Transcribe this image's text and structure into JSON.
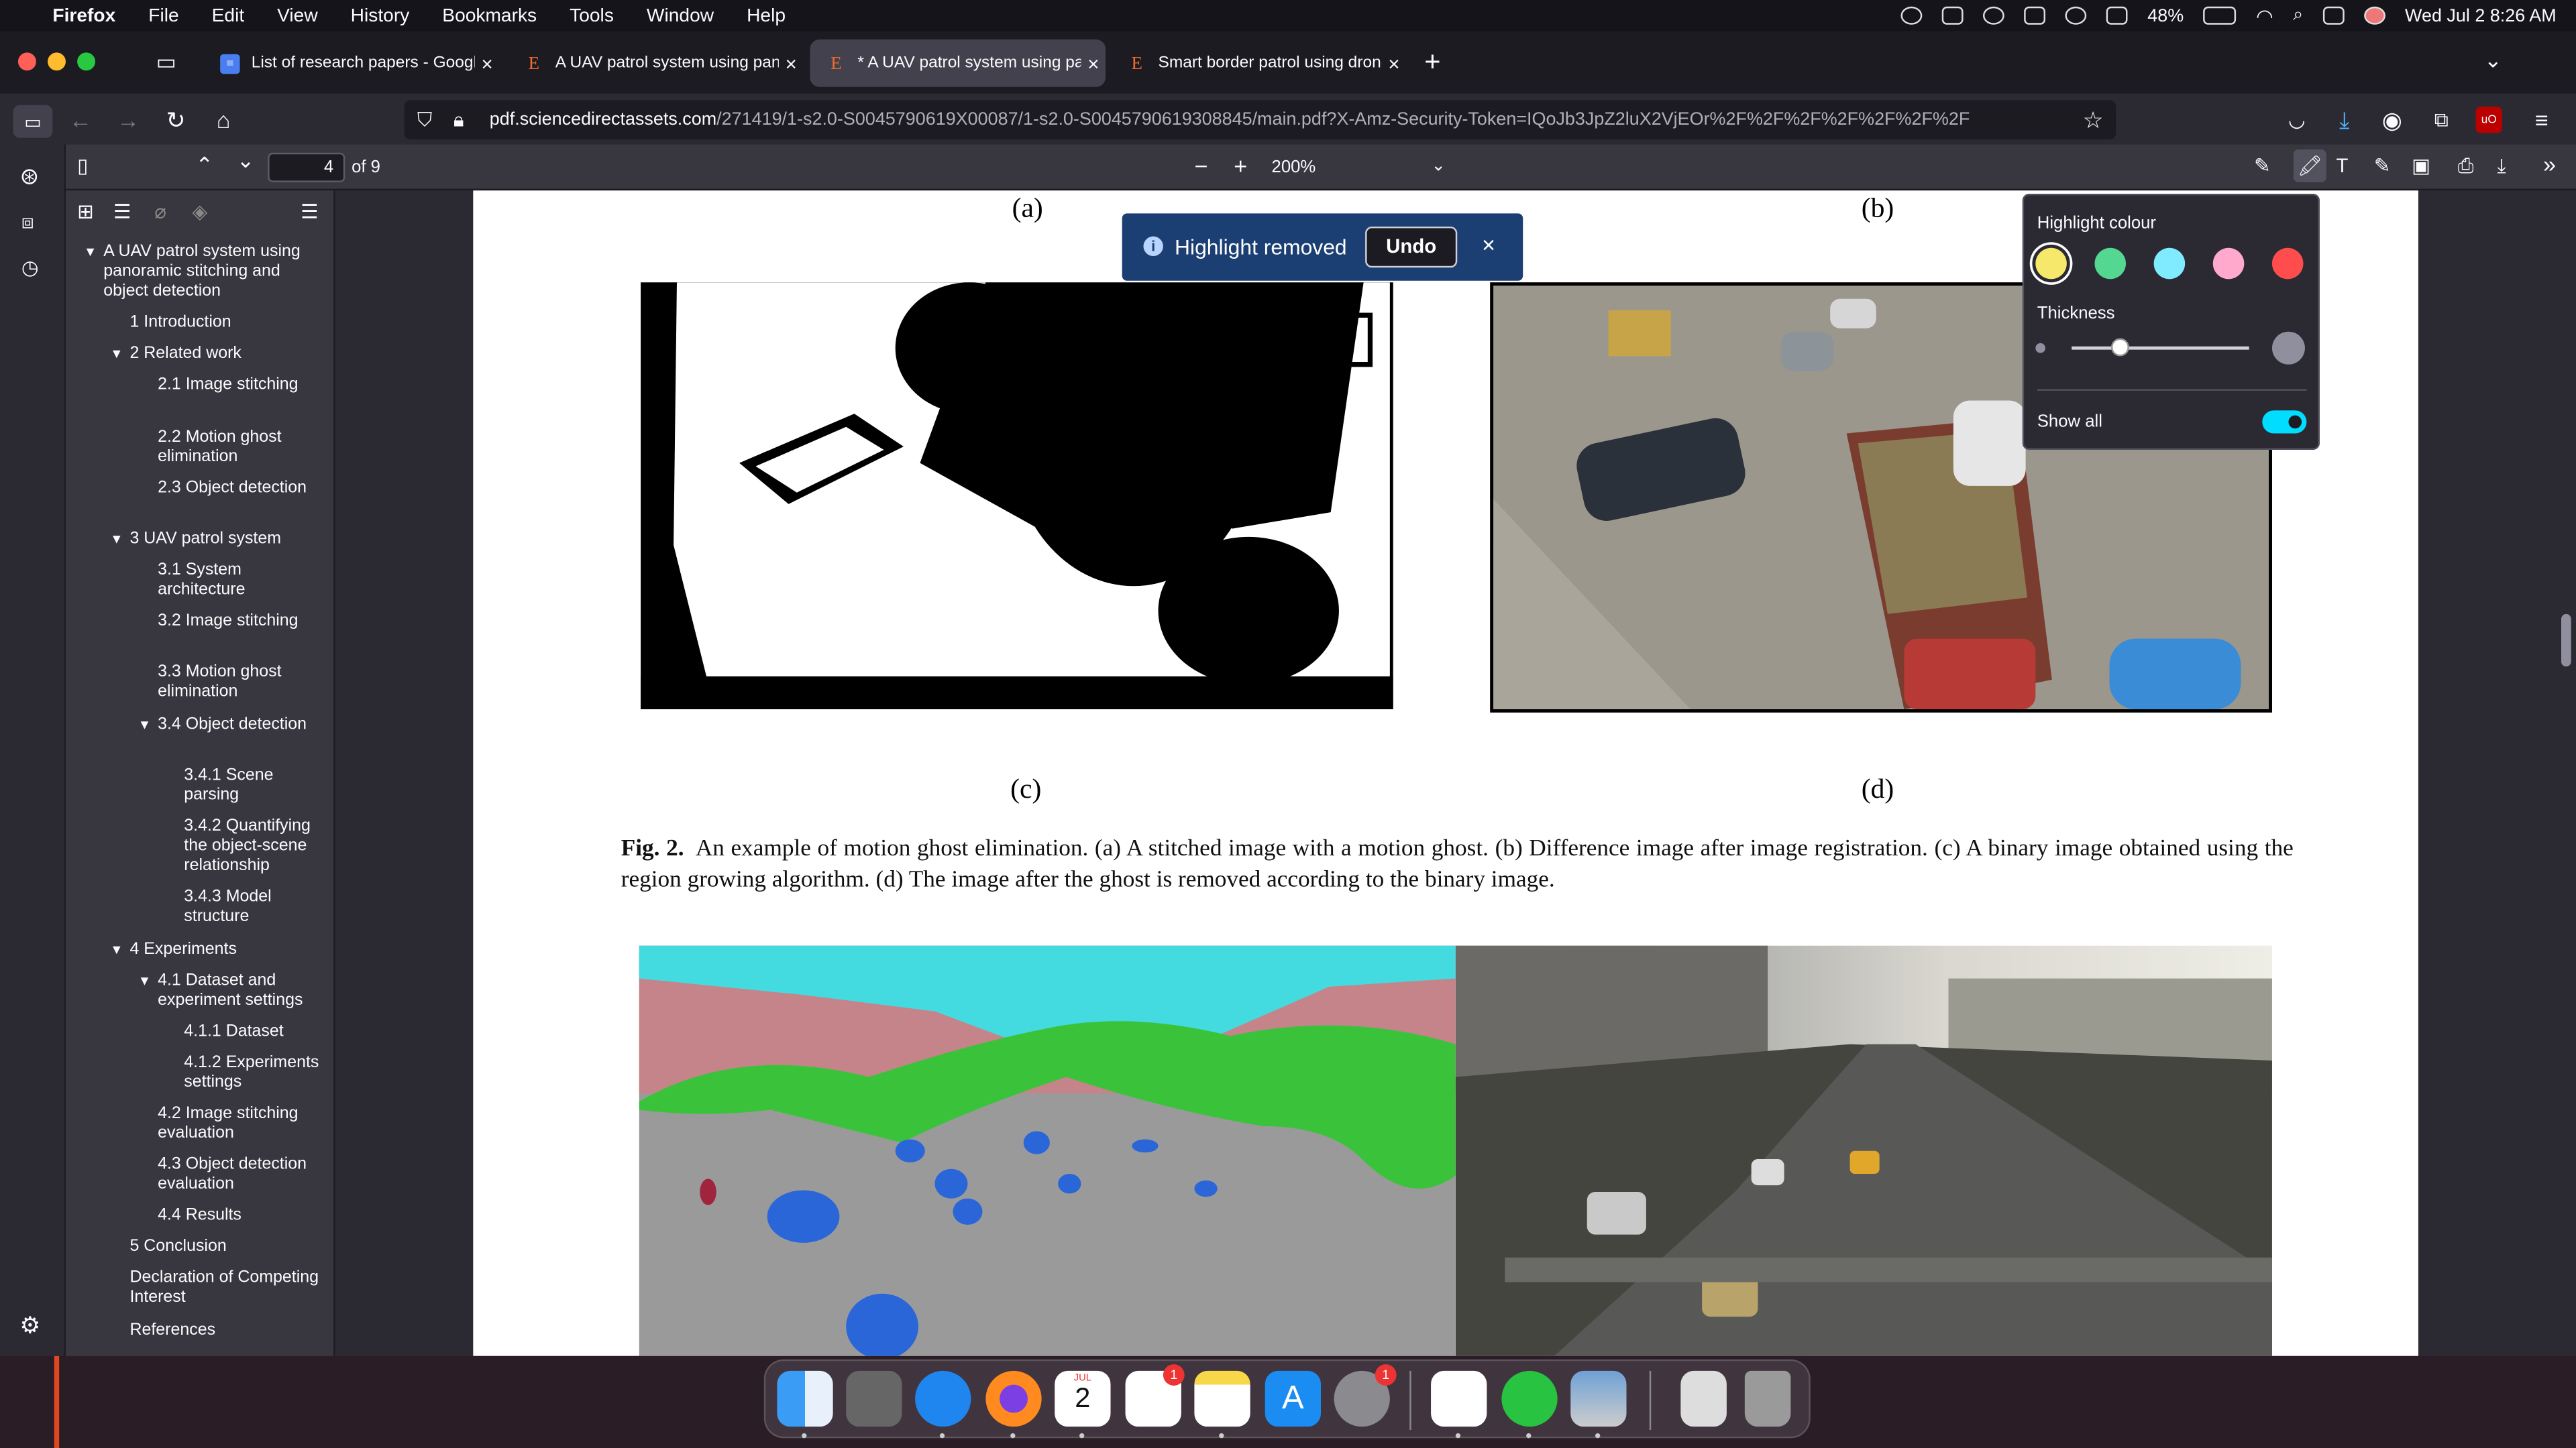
{
  "menubar": {
    "app": "Firefox",
    "items": [
      "File",
      "Edit",
      "View",
      "History",
      "Bookmarks",
      "Tools",
      "Window",
      "Help"
    ],
    "battery": "48%",
    "datetime": "Wed Jul 2  8:26 AM"
  },
  "tabs": [
    {
      "title": "List of research papers - Googl"
    },
    {
      "title": "A UAV patrol system using pano"
    },
    {
      "title": "* A UAV patrol system using par"
    },
    {
      "title": "Smart border patrol using drone"
    }
  ],
  "url": {
    "domain": "pdf.sciencedirectassets.com",
    "path": "/271419/1-s2.0-S0045790619X00087/1-s2.0-S0045790619308845/main.pdf?X-Amz-Security-Token=IQoJb3JpZ2luX2VjEOr%2F%2F%2F%2F%2F%2F%2F"
  },
  "pdf_toolbar": {
    "page": "4",
    "of_pages": "of 9",
    "zoom": "200%"
  },
  "outline": [
    {
      "label": "A UAV patrol system using panoramic stitching and object detection",
      "level": 0,
      "open": true
    },
    {
      "label": "1 Introduction",
      "level": 1
    },
    {
      "label": "2 Related work",
      "level": 1,
      "open": true
    },
    {
      "label": "2.1 Image stitching",
      "level": 2
    },
    {
      "label": "2.2 Motion ghost elimination",
      "level": 2
    },
    {
      "label": "2.3 Object detection",
      "level": 2
    },
    {
      "label": "3 UAV patrol system",
      "level": 1,
      "open": true
    },
    {
      "label": "3.1 System architecture",
      "level": 2
    },
    {
      "label": "3.2 Image stitching",
      "level": 2
    },
    {
      "label": "3.3 Motion ghost elimination",
      "level": 2
    },
    {
      "label": "3.4 Object detection",
      "level": 2,
      "open": true
    },
    {
      "label": "3.4.1 Scene parsing",
      "level": 3
    },
    {
      "label": "3.4.2 Quantifying the object-scene relationship",
      "level": 3
    },
    {
      "label": "3.4.3 Model structure",
      "level": 3
    },
    {
      "label": "4 Experiments",
      "level": 1,
      "open": true
    },
    {
      "label": "4.1 Dataset and experiment settings",
      "level": 2,
      "open": true
    },
    {
      "label": "4.1.1 Dataset",
      "level": 3
    },
    {
      "label": "4.1.2 Experiments settings",
      "level": 3
    },
    {
      "label": "4.2 Image stitching evaluation",
      "level": 2
    },
    {
      "label": "4.3 Object detection evaluation",
      "level": 2
    },
    {
      "label": "4.4 Results",
      "level": 2
    },
    {
      "label": "5 Conclusion",
      "level": 1
    },
    {
      "label": "Declaration of Competing Interest",
      "level": 1
    },
    {
      "label": "References",
      "level": 1
    }
  ],
  "page": {
    "label_a": "(a)",
    "label_b": "(b)",
    "label_c": "(c)",
    "label_d": "(d)",
    "fig_label": "Fig. 2.",
    "fig_caption": "An example of motion ghost elimination. (a) A stitched image with a motion ghost. (b) Difference image after image registration. (c) A binary image obtained using the region growing algorithm. (d) The image after the ghost is removed according to the binary image."
  },
  "toast": {
    "message": "Highlight removed",
    "action": "Undo"
  },
  "highlight_popup": {
    "colour_title": "Highlight colour",
    "thickness_title": "Thickness",
    "thickness_value": 0.15,
    "show_all_label": "Show all",
    "show_all_on": true,
    "colors": [
      "#f5e86b",
      "#54d790",
      "#80ebff",
      "#ffaacc",
      "#ff4d4d"
    ]
  },
  "dock": {
    "calendar_month": "JUL",
    "calendar_day": "2",
    "reminders_badge": "1",
    "settings_badge": "1"
  }
}
